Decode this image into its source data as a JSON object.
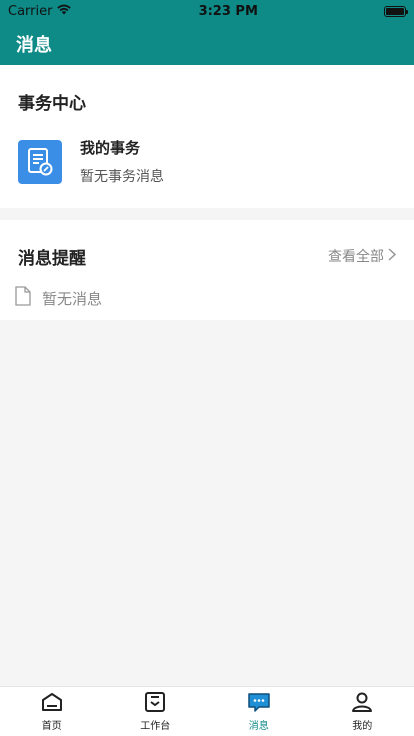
{
  "status_bar": {
    "carrier": "Carrier",
    "time": "3:23 PM"
  },
  "nav": {
    "title": "消息"
  },
  "affairs": {
    "title": "事务中心",
    "item": {
      "title": "我的事务",
      "subtitle": "暂无事务消息"
    }
  },
  "messages": {
    "title": "消息提醒",
    "view_all": "查看全部",
    "empty_text": "暂无消息"
  },
  "tabs": [
    {
      "label": "首页",
      "icon": "home-icon"
    },
    {
      "label": "工作台",
      "icon": "workbench-icon"
    },
    {
      "label": "消息",
      "icon": "message-icon",
      "active": true
    },
    {
      "label": "我的",
      "icon": "profile-icon"
    }
  ],
  "colors": {
    "brand": "#0e8a87",
    "affair_icon": "#3a8ee6"
  }
}
